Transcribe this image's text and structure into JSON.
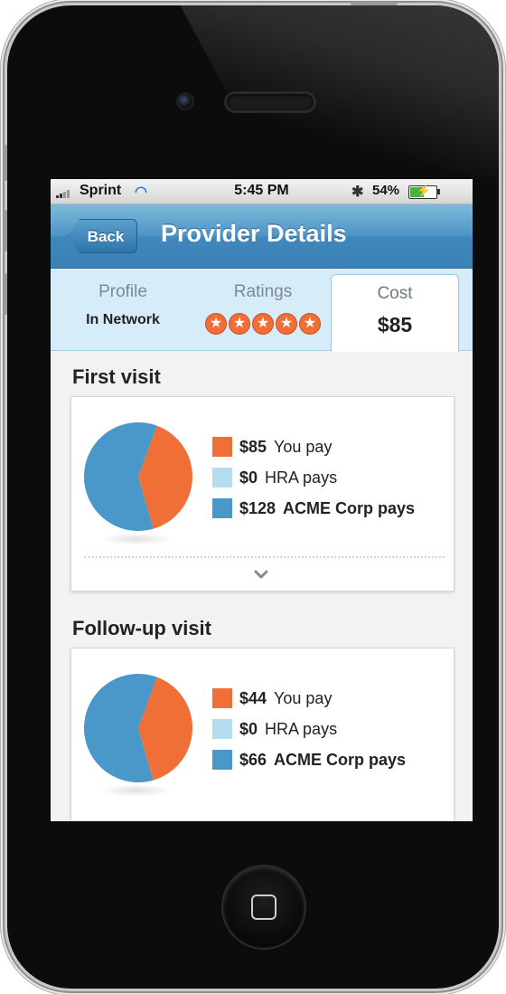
{
  "status_bar": {
    "carrier": "Sprint",
    "time": "5:45 PM",
    "battery_percent": "54%",
    "battery_level": 0.54,
    "wifi_icon": "wifi-icon",
    "bluetooth_icon": "bluetooth-icon"
  },
  "nav": {
    "back_label": "Back",
    "title": "Provider Details"
  },
  "tabs": [
    {
      "label": "Profile",
      "value": "In Network"
    },
    {
      "label": "Ratings",
      "rating": 5,
      "max_rating": 5
    },
    {
      "label": "Cost",
      "value": "$85",
      "selected": true
    }
  ],
  "colors": {
    "you_pay": "#ef6f37",
    "hra_pays": "#b5dcef",
    "employer_pays": "#4a97c9",
    "nav_blue": "#4f96c7"
  },
  "sections": [
    {
      "title": "First visit",
      "items": [
        {
          "amount": "$85",
          "label": "You pay",
          "value": 85
        },
        {
          "amount": "$0",
          "label": "HRA pays",
          "value": 0
        },
        {
          "amount": "$128",
          "label": "ACME Corp pays",
          "value": 128
        }
      ]
    },
    {
      "title": "Follow-up visit",
      "items": [
        {
          "amount": "$44",
          "label": "You pay",
          "value": 44
        },
        {
          "amount": "$0",
          "label": "HRA pays",
          "value": 0
        },
        {
          "amount": "$66",
          "label": "ACME Corp pays",
          "value": 66
        }
      ]
    }
  ]
}
